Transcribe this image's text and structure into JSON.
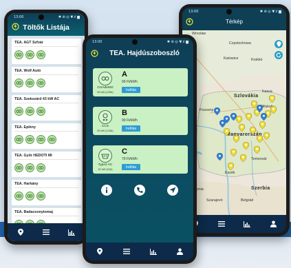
{
  "screen1": {
    "status_time": "13:00",
    "status_icons": "✱ ⊕ ◎ ▼.ıl ▆",
    "title": "Töltők Listája",
    "stations": [
      {
        "name": "TEA. AGT Szfvár",
        "plugs": 3
      },
      {
        "name": "TEA. Wolf Autó",
        "plugs": 3
      },
      {
        "name": "TEA. Szekszárd 43 kW AC",
        "plugs": 3
      },
      {
        "name": "TEA. Eplény",
        "plugs": 4
      },
      {
        "name": "TEA. Győr HEDOTI MI",
        "plugs": 3
      },
      {
        "name": "TEA. Harkány",
        "plugs": 3
      },
      {
        "name": "TEA. Badacsonytomaj",
        "plugs": 3
      }
    ]
  },
  "screen2": {
    "status_time": "13:00",
    "status_icons": "✱ ⊕ ◎ ▼.ıl ▆",
    "title": "TEA. Hajdúszoboszló",
    "connectors": [
      {
        "letter": "A",
        "name": "CHAdeMO",
        "power": "50 kW (125A)",
        "price": "99 Ft/kWh",
        "button": "Indítás"
      },
      {
        "letter": "B",
        "name": "CCS",
        "power": "50 kW (125A)",
        "price": "99 Ft/kWh",
        "button": "Indítás"
      },
      {
        "letter": "C",
        "name": "Type2 AC",
        "power": "22 kW (32A)",
        "price": "79 Ft/kWh",
        "button": "Indítás"
      }
    ]
  },
  "screen3": {
    "status_time": "13:00",
    "status_icons": "✱ ⊕ ◎ ▼.ıl ▆",
    "title": "Térkép",
    "map_labels": {
      "wroclaw": "Wrocław",
      "czestochowa": "Częstochowa",
      "katowice": "Katowice",
      "krakko": "Krakkó",
      "szlovakia": "Szlovákia",
      "kassa": "Kassa",
      "pozsony": "Pozsony",
      "miskolc": "Miskolc",
      "magyarorszag": "Magyarország",
      "temesvar": "Temesvár",
      "eszek": "Eszék",
      "szerbia": "Szerbia",
      "szarajevo": "Szarajevó",
      "belgrad": "Belgrád",
      "bosznia": "Bosznia"
    }
  },
  "colors": {
    "header_dark": "#0f3f55",
    "plug_fill": "#b9e6a5",
    "start_button": "#2f9dd4",
    "tabbar": "#0d2a4a",
    "pin_yellow": "#f2dc2b",
    "pin_blue": "#2a7fd9"
  },
  "icons": {
    "tabbar": [
      "location-pin-icon",
      "list-icon",
      "chart-icon",
      "user-icon"
    ],
    "actions": [
      "info-icon",
      "phone-icon",
      "navigate-icon"
    ]
  }
}
